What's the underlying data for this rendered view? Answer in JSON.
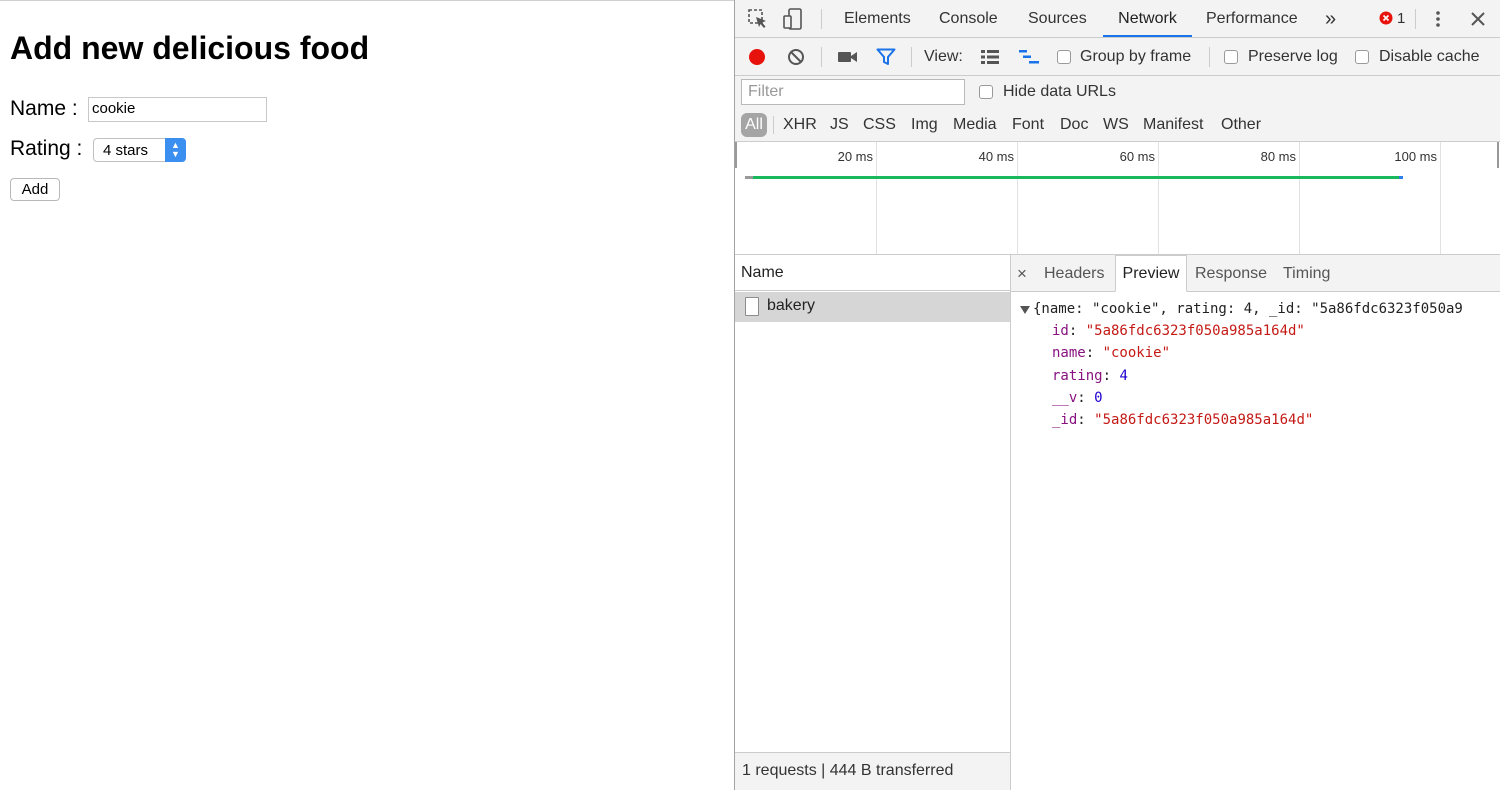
{
  "page": {
    "heading": "Add new delicious food",
    "name_label": "Name :",
    "name_value": "cookie",
    "rating_label": "Rating :",
    "rating_value": "4 stars",
    "add_button": "Add"
  },
  "devtools": {
    "tabs": [
      "Elements",
      "Console",
      "Sources",
      "Network",
      "Performance"
    ],
    "active_tab": "Network",
    "more_tabs": "»",
    "error_count": "1",
    "toolbar": {
      "view_label": "View:",
      "group_by_frame": "Group by frame",
      "preserve_log": "Preserve log",
      "disable_cache": "Disable cache"
    },
    "filter": {
      "placeholder": "Filter",
      "hide_data_urls": "Hide data URLs",
      "types": [
        "All",
        "XHR",
        "JS",
        "CSS",
        "Img",
        "Media",
        "Font",
        "Doc",
        "WS",
        "Manifest",
        "Other"
      ]
    },
    "overview_ticks": [
      "20 ms",
      "40 ms",
      "60 ms",
      "80 ms",
      "100 ms"
    ],
    "requests": {
      "column_name": "Name",
      "rows": [
        "bakery"
      ],
      "status": "1 requests | 444 B transferred"
    },
    "detail": {
      "close": "×",
      "tabs": [
        "Headers",
        "Preview",
        "Response",
        "Timing"
      ],
      "active_tab": "Preview",
      "summary": "{name: \"cookie\", rating: 4, _id: \"5a86fdc6323f050a9",
      "fields": [
        {
          "key": "id",
          "value": "\"5a86fdc6323f050a985a164d\"",
          "type": "string"
        },
        {
          "key": "name",
          "value": "\"cookie\"",
          "type": "string"
        },
        {
          "key": "rating",
          "value": "4",
          "type": "number"
        },
        {
          "key": "__v",
          "value": "0",
          "type": "number"
        },
        {
          "key": "_id",
          "value": "\"5a86fdc6323f050a985a164d\"",
          "type": "string"
        }
      ]
    }
  },
  "colors": {
    "accent": "#1a73e8",
    "record": "#e8120c",
    "timeline_green": "#1ab85c",
    "json_key": "#881280",
    "json_string": "#c41a16",
    "json_number": "#1c00cf"
  },
  "icons": [
    "inspect-element-icon",
    "device-toolbar-icon",
    "error-icon",
    "kebab-menu-icon",
    "close-icon",
    "record-icon",
    "clear-icon",
    "screenshot-camera-icon",
    "filter-icon",
    "large-rows-icon",
    "waterfall-icon",
    "expand-triangle-icon",
    "document-icon"
  ]
}
